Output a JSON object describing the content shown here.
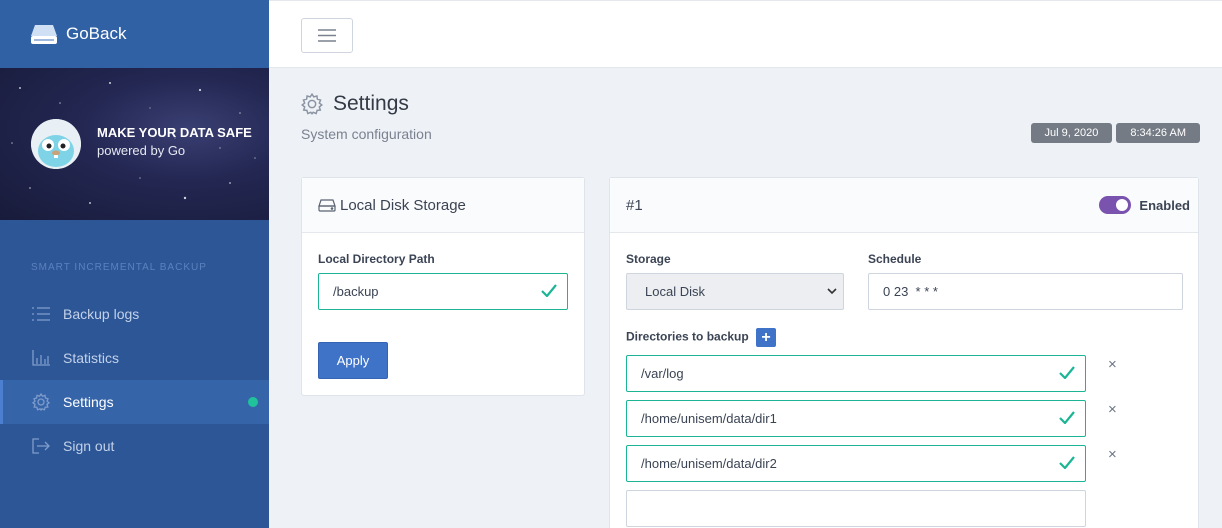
{
  "app": {
    "name": "GoBack"
  },
  "hero": {
    "title": "MAKE YOUR DATA SAFE",
    "subtitle": "powered by Go"
  },
  "sidebar": {
    "section_title": "SMART INCREMENTAL BACKUP",
    "items": [
      {
        "label": "Backup logs",
        "icon": "list-icon",
        "active": false
      },
      {
        "label": "Statistics",
        "icon": "bar-chart-icon",
        "active": false
      },
      {
        "label": "Settings",
        "icon": "gear-icon",
        "active": true
      },
      {
        "label": "Sign out",
        "icon": "sign-out-icon",
        "active": false
      }
    ]
  },
  "page": {
    "title": "Settings",
    "subtitle": "System configuration",
    "date": "Jul 9, 2020",
    "time": "8:34:26 AM"
  },
  "local_disk": {
    "title": "Local Disk Storage",
    "path_label": "Local Directory Path",
    "path_value": "/backup",
    "apply_label": "Apply"
  },
  "job": {
    "title": "#1",
    "enabled_label": "Enabled",
    "enabled": true,
    "storage_label": "Storage",
    "storage_value": "Local Disk",
    "schedule_label": "Schedule",
    "schedule_value": "0 23  * * *",
    "dirs_label": "Directories to backup",
    "dirs": [
      "/var/log",
      "/home/unisem/data/dir1",
      "/home/unisem/data/dir2",
      ""
    ]
  },
  "colors": {
    "sidebar": "#2d5696",
    "accent": "#3f73c8",
    "valid": "#1bb596",
    "toggle": "#7953ad",
    "badge": "#747b85"
  }
}
